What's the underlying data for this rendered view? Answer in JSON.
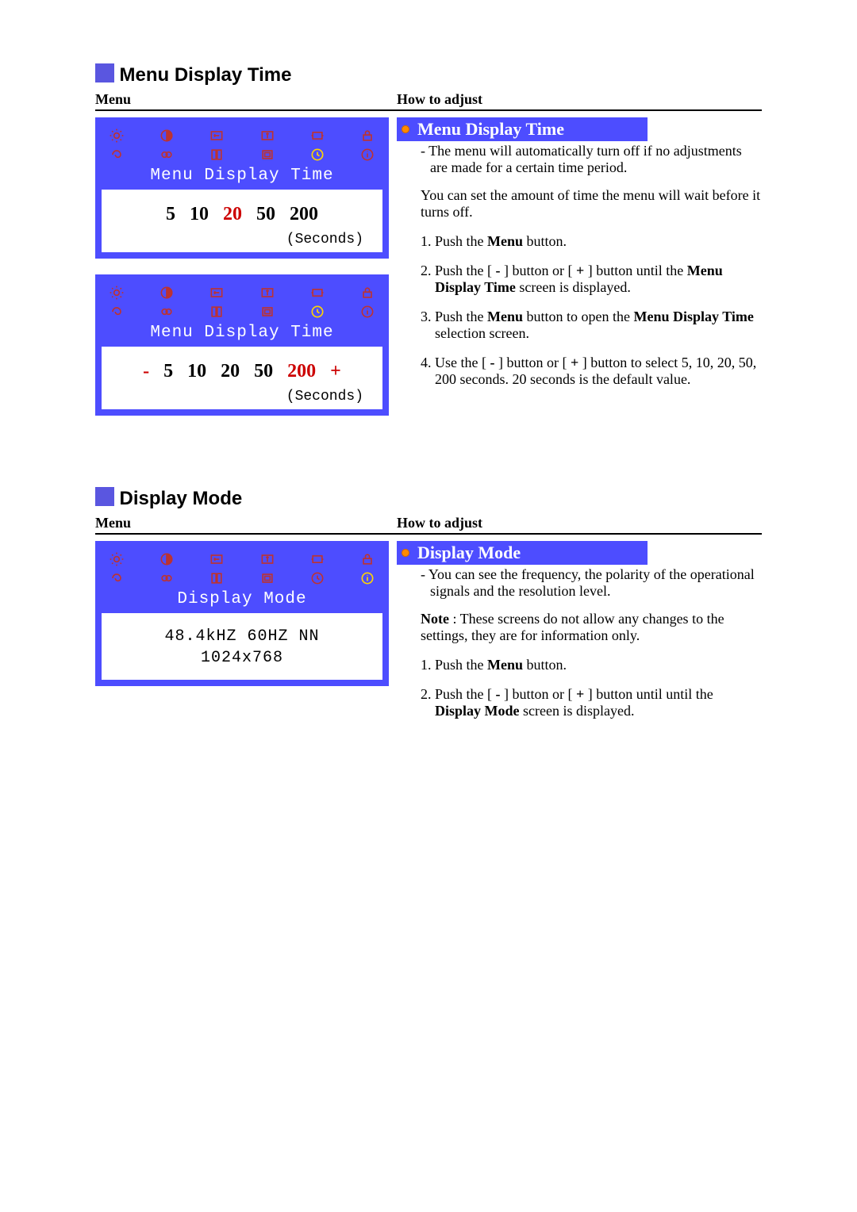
{
  "section1": {
    "title": "Menu Display Time",
    "col_left_header": "Menu",
    "col_right_header": "How to adjust",
    "osd1": {
      "title": "Menu Display Time",
      "values": [
        "5",
        "10",
        "20",
        "50",
        "200"
      ],
      "selected_index": 2,
      "unit": "(Seconds)"
    },
    "osd2": {
      "title": "Menu Display Time",
      "minus": "-",
      "values": [
        "5",
        "10",
        "20",
        "50",
        "200"
      ],
      "plus": "+",
      "selected_index": 4,
      "unit": "(Seconds)"
    },
    "right_heading": "Menu Display Time",
    "desc_dash": "The menu will automatically turn off if no adjustments are made for a certain time period.",
    "desc_para": "You can set the amount of time the menu will wait before it turns off.",
    "step1_a": "Push the ",
    "step1_b": "Menu",
    "step1_c": " button.",
    "step2_a": "Push the [ ",
    "step2_b": "-",
    "step2_c": " ] button or [ ",
    "step2_d": "+",
    "step2_e": " ] button until the ",
    "step2_f": "Menu Display Time",
    "step2_g": " screen is displayed.",
    "step3_a": "Push the ",
    "step3_b": "Menu",
    "step3_c": " button to open the ",
    "step3_d": "Menu Display Time",
    "step3_e": " selection screen.",
    "step4_a": "Use the [ ",
    "step4_b": "-",
    "step4_c": " ] button or [ ",
    "step4_d": "+",
    "step4_e": " ] button to select 5, 10, 20, 50, 200 seconds. 20 seconds is the default value."
  },
  "section2": {
    "title": "Display Mode",
    "col_left_header": "Menu",
    "col_right_header": "How to adjust",
    "osd": {
      "title": "Display Mode",
      "line1": "48.4kHZ  60HZ NN",
      "line2": "1024x768"
    },
    "right_heading": "Display Mode",
    "desc_dash": "You can see the frequency, the polarity of the operational signals and the resolution level.",
    "note_label": "Note",
    "note_text": " : These screens do not allow any changes to the settings, they are for information only.",
    "step1_a": "Push the ",
    "step1_b": "Menu",
    "step1_c": " button.",
    "step2_a": "Push the [ ",
    "step2_b": "-",
    "step2_c": " ] button or [ ",
    "step2_d": "+",
    "step2_e": " ] button until until the ",
    "step2_f": "Display Mode",
    "step2_g": " screen is displayed."
  }
}
